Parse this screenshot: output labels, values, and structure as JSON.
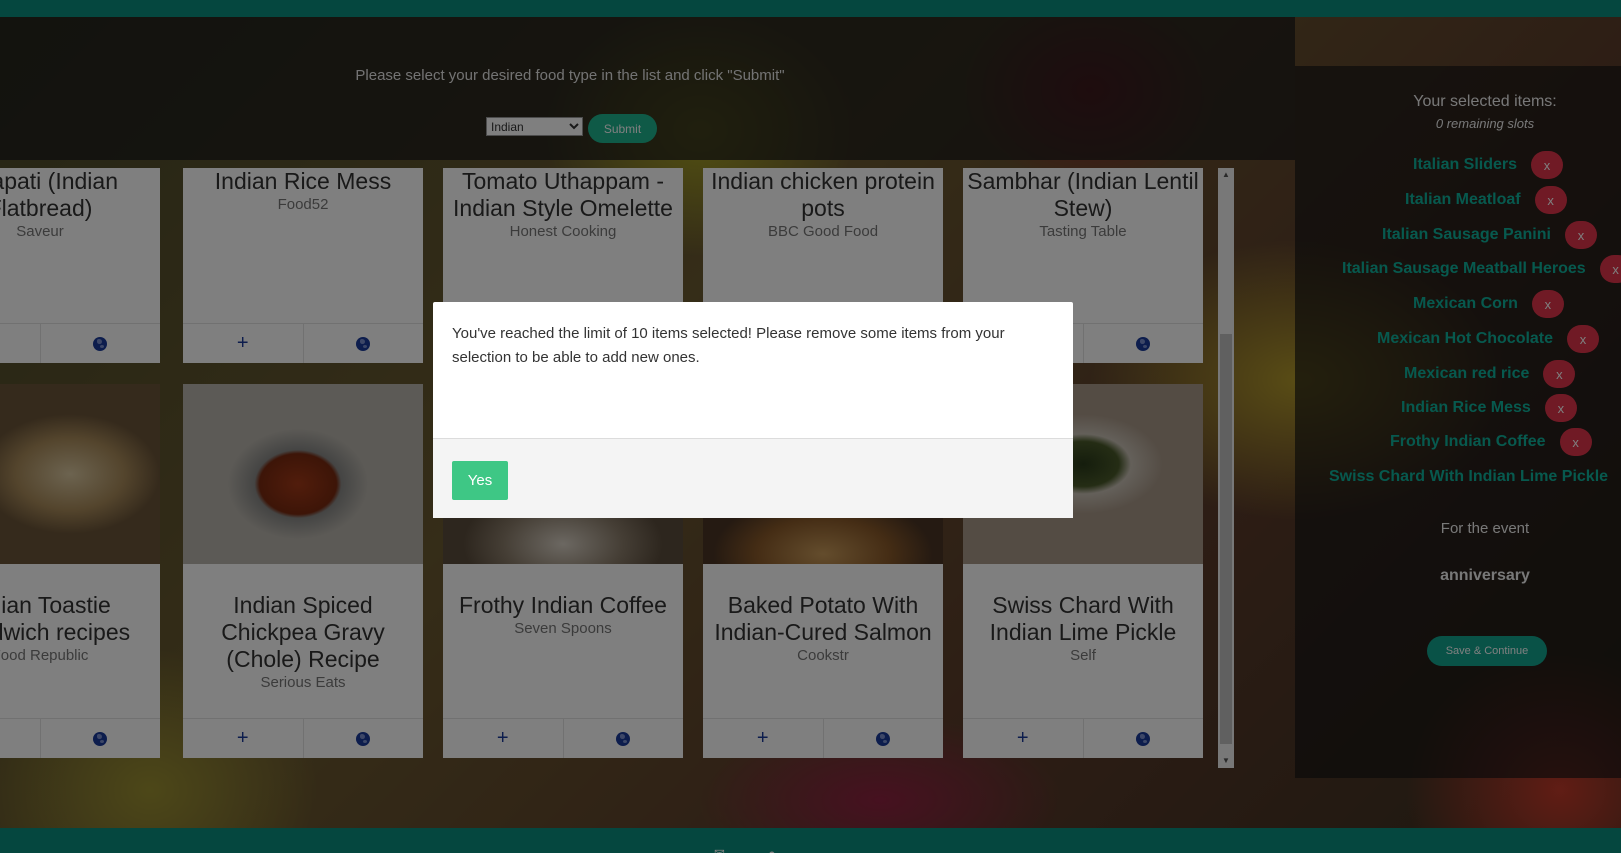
{
  "header": {
    "instruction": "Please select your desired food type in the list and click \"Submit\"",
    "food_type_selected": "Indian",
    "submit_label": "Submit"
  },
  "recipes_row1": [
    {
      "title": "Chapati (Indian Flatbread)",
      "source": "Saveur"
    },
    {
      "title": "Indian Rice Mess",
      "source": "Food52"
    },
    {
      "title": "Tomato Uthappam - Indian Style Omelette",
      "source": "Honest Cooking"
    },
    {
      "title": "Indian chicken protein pots",
      "source": "BBC Good Food"
    },
    {
      "title": "Sambhar (Indian Lentil Stew)",
      "source": "Tasting Table"
    }
  ],
  "recipes_row2": [
    {
      "title": "Indian Toastie Sandwich recipes",
      "source": "Food Republic"
    },
    {
      "title": "Indian Spiced Chickpea Gravy (Chole) Recipe",
      "source": "Serious Eats"
    },
    {
      "title": "Frothy Indian Coffee",
      "source": "Seven Spoons"
    },
    {
      "title": "Baked Potato With Indian-Cured Salmon",
      "source": "Cookstr"
    },
    {
      "title": "Swiss Chard With Indian Lime Pickle",
      "source": "Self"
    }
  ],
  "card_actions": {
    "add": "+"
  },
  "sidebar": {
    "title": "Your selected items:",
    "remaining": "0 remaining slots",
    "items": [
      "Italian Sliders",
      "Italian Meatloaf",
      "Italian Sausage Panini",
      "Italian Sausage Meatball Heroes",
      "Mexican Corn",
      "Mexican Hot Chocolate",
      "Mexican red rice",
      "Indian Rice Mess",
      "Frothy Indian Coffee",
      "Swiss Chard With Indian Lime Pickle"
    ],
    "remove_label": "x",
    "event_label": "For the event",
    "event_name": "anniversary",
    "save_label": "Save & Continue"
  },
  "modal": {
    "message": "You've reached the limit of 10 items selected! Please remove some items from your selection to be able to add new ones.",
    "yes_label": "Yes"
  },
  "colors": {
    "brand": "#0a8f7e",
    "accent_green": "#3ec785",
    "remove_red": "#e0344a",
    "action_blue": "#1a3a9a"
  }
}
